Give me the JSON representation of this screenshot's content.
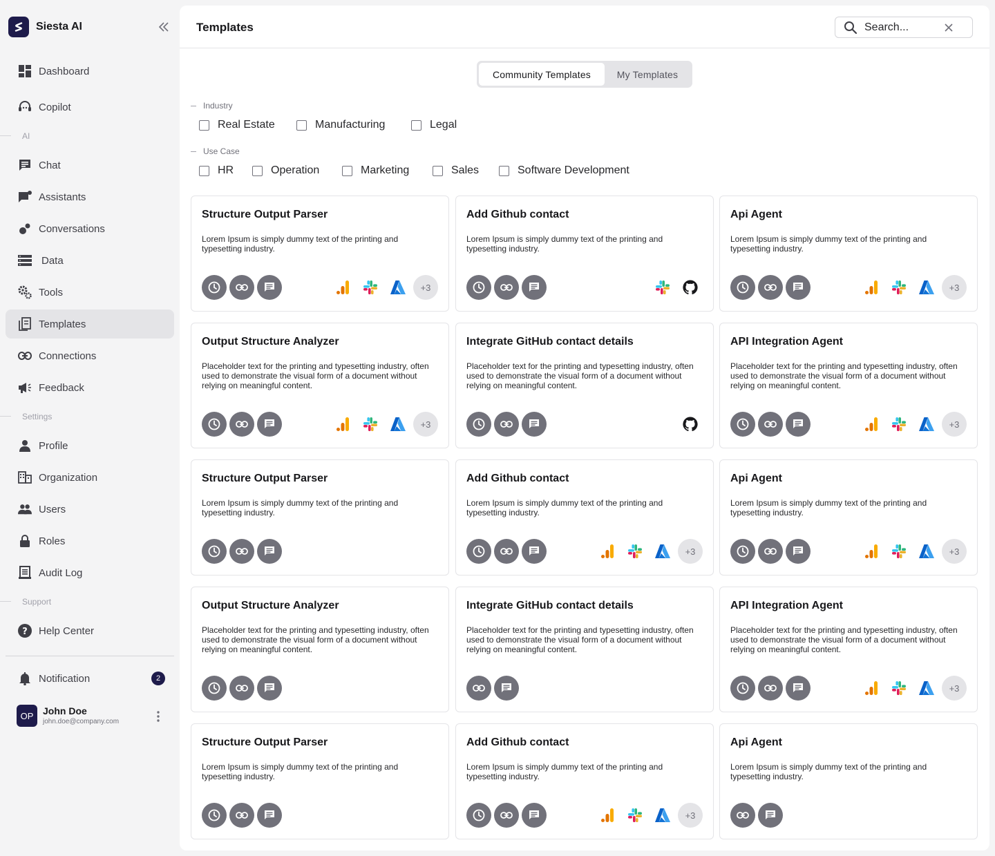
{
  "app": {
    "name": "Siesta AI"
  },
  "sidebar": {
    "nav": [
      {
        "label": "Dashboard",
        "icon": "dashboard-icon"
      },
      {
        "label": "Copilot",
        "icon": "headset-icon"
      },
      {
        "label": "Chat",
        "icon": "chat-icon"
      },
      {
        "label": "Assistants",
        "icon": "assistants-icon"
      },
      {
        "label": "Conversations",
        "icon": "conversations-icon"
      },
      {
        "label": "Data",
        "icon": "data-icon"
      },
      {
        "label": "Tools",
        "icon": "tools-icon"
      },
      {
        "label": "Templates",
        "icon": "templates-icon",
        "active": true
      },
      {
        "label": "Connections",
        "icon": "link-icon"
      },
      {
        "label": "Feedback",
        "icon": "megaphone-icon"
      },
      {
        "label": "Profile",
        "icon": "person-icon"
      },
      {
        "label": "Organization",
        "icon": "building-icon"
      },
      {
        "label": "Users",
        "icon": "users-icon"
      },
      {
        "label": "Roles",
        "icon": "lock-icon"
      },
      {
        "label": "Audit Log",
        "icon": "audit-log-icon"
      },
      {
        "label": "Help Center",
        "icon": "help-icon"
      },
      {
        "label": "Notification",
        "icon": "bell-icon"
      }
    ],
    "sections": {
      "ai": "AI",
      "settings": "Settings",
      "support": "Support"
    },
    "notification_count": "2",
    "user": {
      "initials": "OP",
      "name": "John Doe",
      "email": "john.doe@company.com"
    }
  },
  "header": {
    "title": "Templates",
    "search_placeholder": "Search..."
  },
  "tabs": {
    "community": "Community Templates",
    "mine": "My Templates",
    "active": "community"
  },
  "filters": {
    "industry": {
      "label": "Industry",
      "options": [
        "Real Estate",
        "Manufacturing",
        "Legal"
      ]
    },
    "use_case": {
      "label": "Use Case",
      "options": [
        "HR",
        "Operation",
        "Marketing",
        "Sales",
        "Software Development"
      ]
    }
  },
  "cards": [
    {
      "title": "Structure Output Parser",
      "desc": "Lorem Ipsum is simply dummy text of the printing and typesetting industry.",
      "actions": [
        "clock",
        "link",
        "chat"
      ],
      "integrations": [
        "analytics",
        "slack",
        "azure"
      ],
      "more": "+3"
    },
    {
      "title": "Add Github contact",
      "desc": "Lorem Ipsum is simply dummy text of the printing and typesetting industry.",
      "actions": [
        "clock",
        "link",
        "chat"
      ],
      "integrations": [
        "slack",
        "github"
      ],
      "more": ""
    },
    {
      "title": "Api Agent",
      "desc": "Lorem Ipsum is simply dummy text of the printing and typesetting industry.",
      "actions": [
        "clock",
        "link",
        "chat"
      ],
      "integrations": [
        "analytics",
        "slack",
        "azure"
      ],
      "more": "+3"
    },
    {
      "title": "Output Structure Analyzer",
      "desc": "Placeholder text for the printing and typesetting industry, often used to demonstrate the visual form of a document without relying on meaningful content.",
      "actions": [
        "clock",
        "link",
        "chat"
      ],
      "integrations": [
        "analytics",
        "slack",
        "azure"
      ],
      "more": "+3"
    },
    {
      "title": "Integrate GitHub contact details",
      "desc": "Placeholder text for the printing and typesetting industry, often used to demonstrate the visual form of a document without relying on meaningful content.",
      "actions": [
        "clock",
        "link",
        "chat"
      ],
      "integrations": [
        "github"
      ],
      "more": ""
    },
    {
      "title": "API Integration Agent",
      "desc": "Placeholder text for the printing and typesetting industry, often used to demonstrate the visual form of a document without relying on meaningful content.",
      "actions": [
        "clock",
        "link",
        "chat"
      ],
      "integrations": [
        "analytics",
        "slack",
        "azure"
      ],
      "more": "+3"
    },
    {
      "title": "Structure Output Parser",
      "desc": "Lorem Ipsum is simply dummy text of the printing and typesetting industry.",
      "actions": [
        "clock",
        "link",
        "chat"
      ],
      "integrations": [],
      "more": ""
    },
    {
      "title": "Add Github contact",
      "desc": "Lorem Ipsum is simply dummy text of the printing and typesetting industry.",
      "actions": [
        "clock",
        "link",
        "chat"
      ],
      "integrations": [
        "analytics",
        "slack",
        "azure"
      ],
      "more": "+3"
    },
    {
      "title": "Api Agent",
      "desc": "Lorem Ipsum is simply dummy text of the printing and typesetting industry.",
      "actions": [
        "clock",
        "link",
        "chat"
      ],
      "integrations": [
        "analytics",
        "slack",
        "azure"
      ],
      "more": "+3"
    },
    {
      "title": "Output Structure Analyzer",
      "desc": "Placeholder text for the printing and typesetting industry, often used to demonstrate the visual form of a document without relying on meaningful content.",
      "actions": [
        "clock",
        "link",
        "chat"
      ],
      "integrations": [],
      "more": ""
    },
    {
      "title": "Integrate GitHub contact details",
      "desc": "Placeholder text for the printing and typesetting industry, often used to demonstrate the visual form of a document without relying on meaningful content.",
      "actions": [
        "link",
        "chat"
      ],
      "integrations": [],
      "more": ""
    },
    {
      "title": "API Integration Agent",
      "desc": "Placeholder text for the printing and typesetting industry, often used to demonstrate the visual form of a document without relying on meaningful content.",
      "actions": [
        "clock",
        "link",
        "chat"
      ],
      "integrations": [
        "analytics",
        "slack",
        "azure"
      ],
      "more": "+3"
    },
    {
      "title": "Structure Output Parser",
      "desc": "Lorem Ipsum is simply dummy text of the printing and typesetting industry.",
      "actions": [
        "clock",
        "link",
        "chat"
      ],
      "integrations": [],
      "more": ""
    },
    {
      "title": "Add Github contact",
      "desc": "Lorem Ipsum is simply dummy text of the printing and typesetting industry.",
      "actions": [
        "clock",
        "link",
        "chat"
      ],
      "integrations": [
        "analytics",
        "slack",
        "azure"
      ],
      "more": "+3"
    },
    {
      "title": "Api Agent",
      "desc": "Lorem Ipsum is simply dummy text of the printing and typesetting industry.",
      "actions": [
        "link",
        "chat"
      ],
      "integrations": [],
      "more": ""
    }
  ],
  "colors": {
    "brand": "#1e1b4b",
    "accent_gray": "#71717a"
  }
}
